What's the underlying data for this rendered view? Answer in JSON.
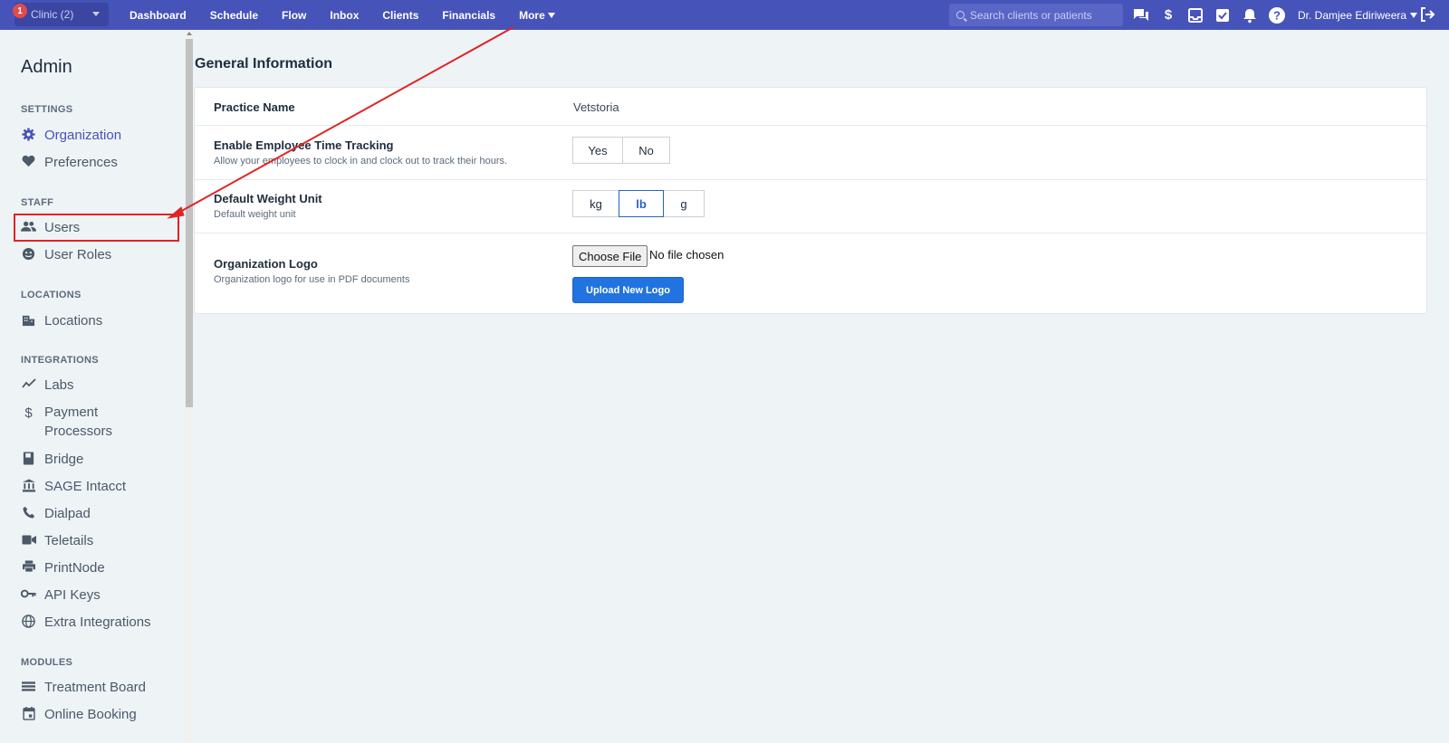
{
  "topbar": {
    "badge_count": "1",
    "clinic_label": "Clinic (2)",
    "nav": [
      "Dashboard",
      "Schedule",
      "Flow",
      "Inbox",
      "Clients",
      "Financials",
      "More"
    ],
    "search_placeholder": "Search clients or patients",
    "user_name": "Dr. Damjee Ediriweera",
    "icons": [
      "chat-icon",
      "dollar-icon",
      "inbox-tray-icon",
      "checkbox-icon",
      "bell-icon",
      "help-icon",
      "logout-icon"
    ]
  },
  "sidebar": {
    "title": "Admin",
    "sections": {
      "settings": "SETTINGS",
      "staff": "STAFF",
      "locations": "LOCATIONS",
      "integrations": "INTEGRATIONS",
      "modules": "MODULES"
    },
    "items": {
      "organization": "Organization",
      "preferences": "Preferences",
      "users": "Users",
      "user_roles": "User Roles",
      "locations": "Locations",
      "labs": "Labs",
      "payment_processors": "Payment Processors",
      "bridge": "Bridge",
      "sage_intacct": "SAGE Intacct",
      "dialpad": "Dialpad",
      "teletails": "Teletails",
      "printnode": "PrintNode",
      "api_keys": "API Keys",
      "extra_integrations": "Extra Integrations",
      "treatment_board": "Treatment Board",
      "online_booking": "Online Booking"
    },
    "active": "Organization"
  },
  "main": {
    "title": "General Information",
    "practice_name_label": "Practice Name",
    "practice_name_value": "Vetstoria",
    "time_tracking_label": "Enable Employee Time Tracking",
    "time_tracking_sub": "Allow your employees to clock in and clock out to track their hours.",
    "yes_label": "Yes",
    "no_label": "No",
    "weight_label": "Default Weight Unit",
    "weight_sub": "Default weight unit",
    "weight_options": [
      "kg",
      "lb",
      "g"
    ],
    "weight_selected": "lb",
    "logo_label": "Organization Logo",
    "logo_sub": "Organization logo for use in PDF documents",
    "choose_file_label": "Choose File",
    "no_file_text": "No file chosen",
    "upload_label": "Upload New Logo"
  },
  "colors": {
    "nav_bg": "#4653b9",
    "accent": "#4653b9",
    "primary_button": "#2073e0",
    "annotation": "#e02424"
  }
}
